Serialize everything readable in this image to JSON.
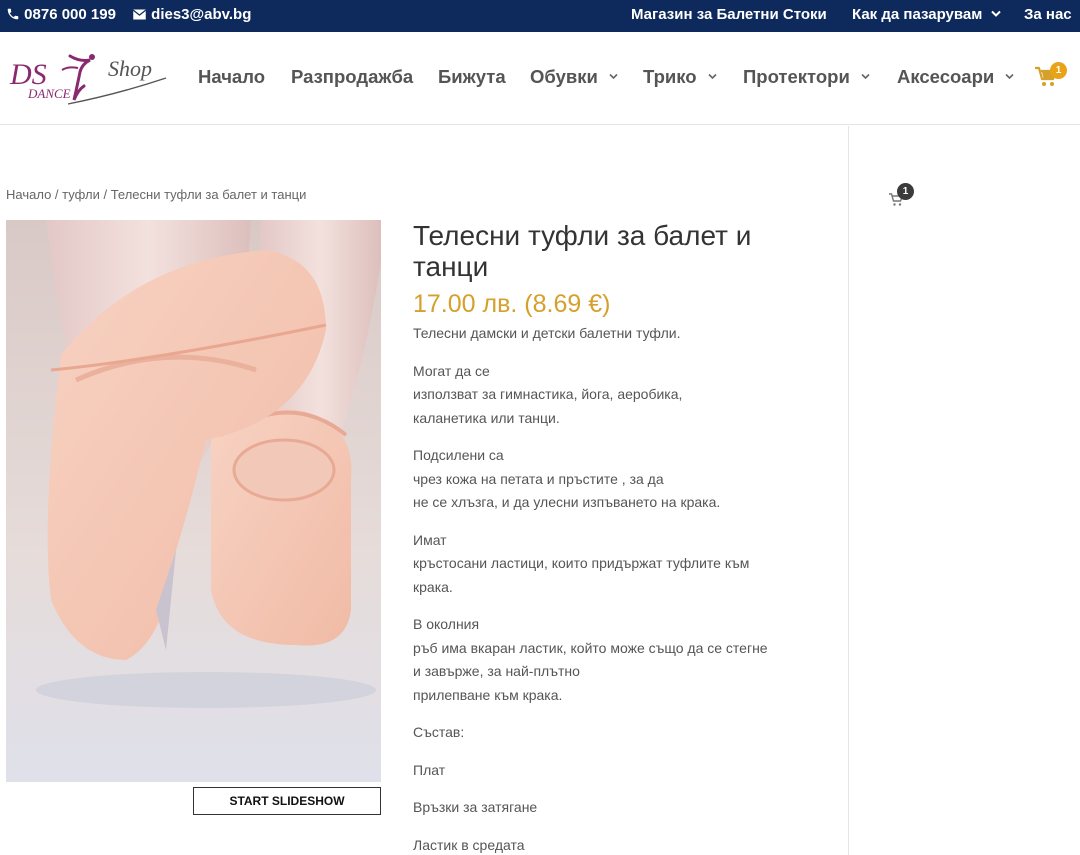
{
  "topbar": {
    "phone": "0876 000 199",
    "email": "dies3@abv.bg",
    "links": [
      "Магазин за Балетни Стоки",
      "Как да пазарувам",
      "За нас"
    ]
  },
  "logo": {
    "ds": "DS",
    "dance": "DANCE",
    "shop": "Shop"
  },
  "nav": {
    "items": [
      "Начало",
      "Разпродажба",
      "Бижута",
      "Обувки",
      "Трико",
      "Протектори",
      "Аксесоари"
    ],
    "cart_count": "1"
  },
  "sidebar": {
    "cart_count": "1"
  },
  "breadcrumb": {
    "home": "Начало",
    "sep1": " / ",
    "category": "туфли",
    "sep2": " / ",
    "current": "Телесни туфли за балет и танци"
  },
  "product": {
    "title": "Телесни туфли за балет и танци",
    "price": "17.00 лв. (8.69 €)",
    "slideshow_label": "START SLIDESHOW",
    "description": [
      [
        "Телесни дамски и детски балетни туфли."
      ],
      [
        "Могат да се",
        "използват за гимнастика, йога, аеробика,",
        "каланетика или танци."
      ],
      [
        "Подсилени са",
        "чрез кожа на петата и пръстите , за да",
        "не се хлъзга, и да улесни изпъването на крака."
      ],
      [
        "Имат",
        "кръстосани ластици, които придържат туфлите към",
        "крака."
      ],
      [
        "В околния",
        "ръб има вкаран ластик, който може също да се стегне",
        "и завърже, за най-плътно",
        "прилепване към крака."
      ],
      [
        "Състав:"
      ],
      [
        "Плат"
      ],
      [
        "Връзки за затягане"
      ],
      [
        "Ластик в средата"
      ]
    ]
  },
  "colors": {
    "topbar": "#0e2a5c",
    "price": "#d5a02c",
    "logo": "#8a2a6e",
    "badge": "#e8a317"
  }
}
